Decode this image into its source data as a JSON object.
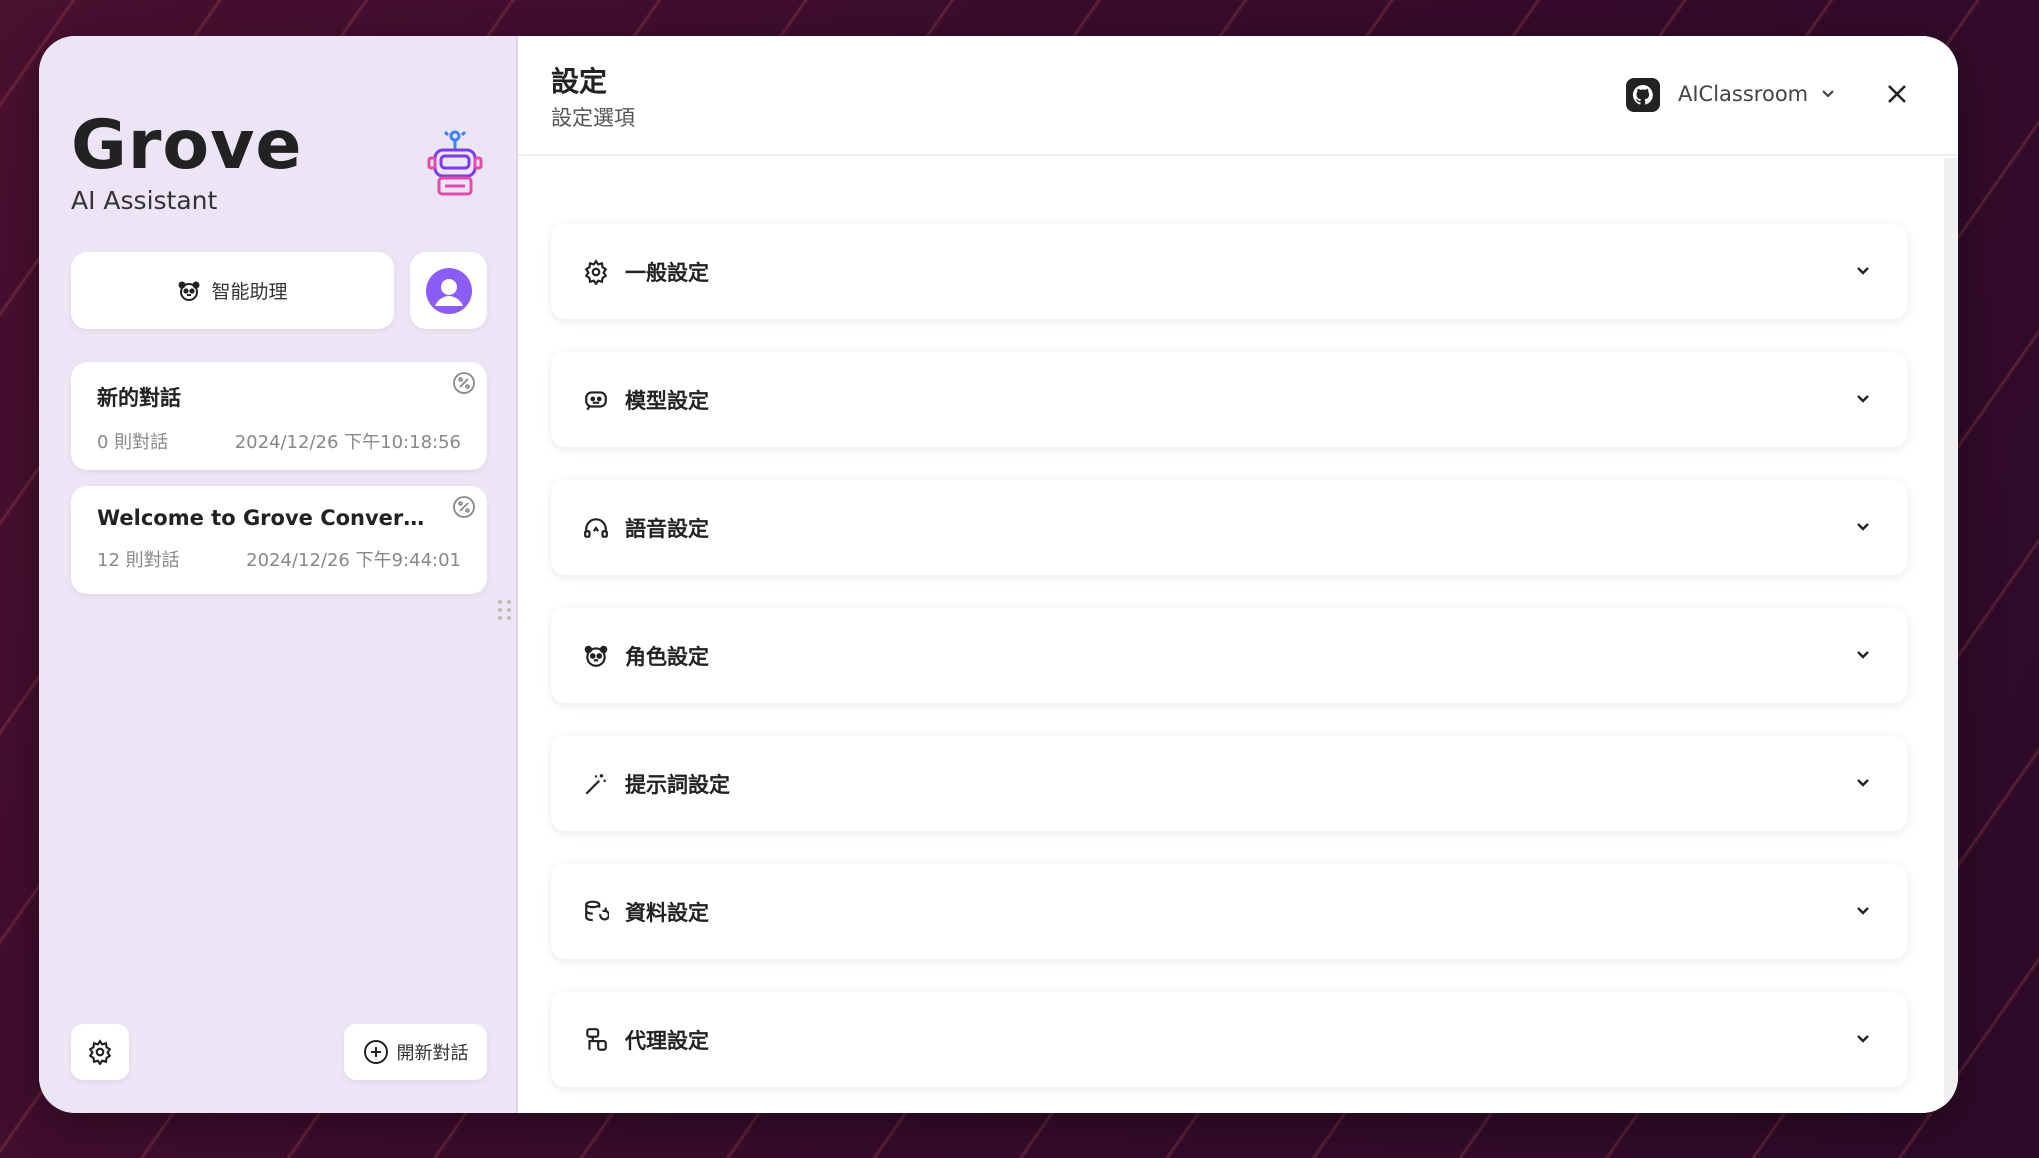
{
  "sidebar": {
    "brand_title": "Grove",
    "brand_subtitle": "AI Assistant",
    "assistant_button": "智能助理",
    "conversations": [
      {
        "title": "新的對話",
        "count": "0 則對話",
        "timestamp": "2024/12/26 下午10:18:56"
      },
      {
        "title": "Welcome to Grove Conversa...",
        "count": "12 則對話",
        "timestamp": "2024/12/26 下午9:44:01"
      }
    ],
    "new_chat_button": "開新對話"
  },
  "header": {
    "title": "設定",
    "subtitle": "設定選項",
    "repo_name": "AIClassroom"
  },
  "settings_sections": [
    {
      "label": "一般設定",
      "icon": "gear-icon"
    },
    {
      "label": "模型設定",
      "icon": "bot-icon"
    },
    {
      "label": "語音設定",
      "icon": "headphones-icon"
    },
    {
      "label": "角色設定",
      "icon": "panda-icon"
    },
    {
      "label": "提示詞設定",
      "icon": "magic-wand-icon"
    },
    {
      "label": "資料設定",
      "icon": "database-icon"
    },
    {
      "label": "代理設定",
      "icon": "network-icon"
    }
  ],
  "colors": {
    "sidebar_bg": "#ebe5f5",
    "avatar_accent": "#8b5cf6",
    "robot_accent": "#e84aa8"
  }
}
